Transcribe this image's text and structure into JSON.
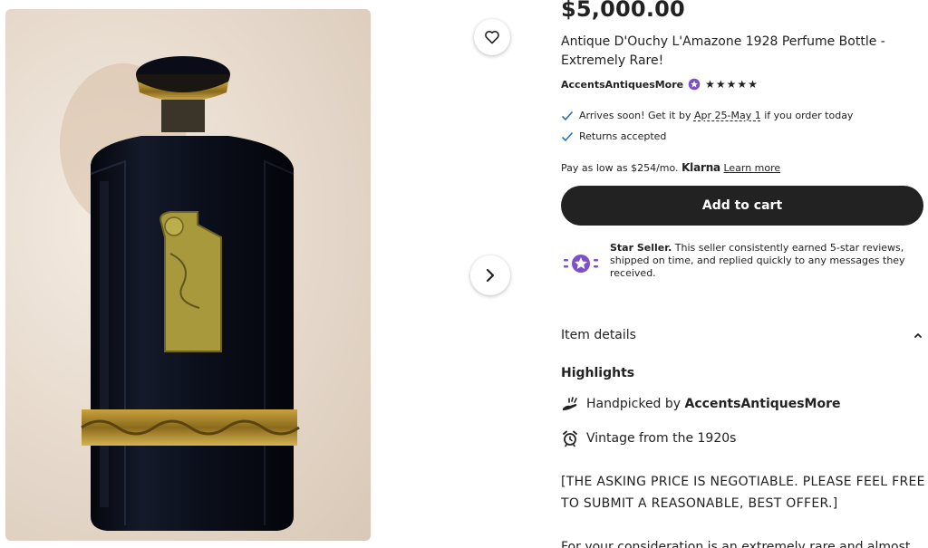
{
  "listing": {
    "price": "$5,000.00",
    "title": "Antique D'Ouchy L'Amazone 1928 Perfume Bottle - Extremely Rare!",
    "shop_name": "AccentsAntiquesMore",
    "rating": "★★★★★",
    "rating_value": 5
  },
  "shipping": {
    "arrives_prefix": "Arrives soon! Get it by",
    "arrives_dates": "Apr 25-May 1",
    "arrives_suffix": "if you order today",
    "returns": "Returns accepted"
  },
  "klarna": {
    "text": "Pay as low as $254/mo.",
    "logo": "Klarna",
    "learn_more": "Learn more"
  },
  "cart": {
    "label": "Add to cart"
  },
  "star_seller": {
    "title": "Star Seller.",
    "text": "This seller consistently earned 5-star reviews, shipped on time, and replied quickly to any messages they received."
  },
  "details": {
    "header": "Item details",
    "highlights": "Highlights",
    "handpicked_prefix": "Handpicked by",
    "handpicked_shop": "AccentsAntiquesMore",
    "vintage": "Vintage from the 1920s",
    "description": "[THE ASKING PRICE IS NEGOTIABLE. PLEASE FEEL FREE TO SUBMIT A REASONABLE, BEST OFFER.]",
    "description_2": "For your consideration is an extremely rare and almost"
  },
  "icons": {
    "favorite": "heart-icon",
    "next": "chevron-right-icon",
    "collapse": "chevron-up-icon",
    "check": "check-icon",
    "star_seller_badge": "star-seller-badge-icon",
    "handpicked": "hand-icon",
    "vintage": "alarm-clock-icon"
  },
  "colors": {
    "text": "#222222",
    "cart_button": "#222222",
    "check": "#2a6ebb",
    "star_seller": "#7e50c7"
  }
}
